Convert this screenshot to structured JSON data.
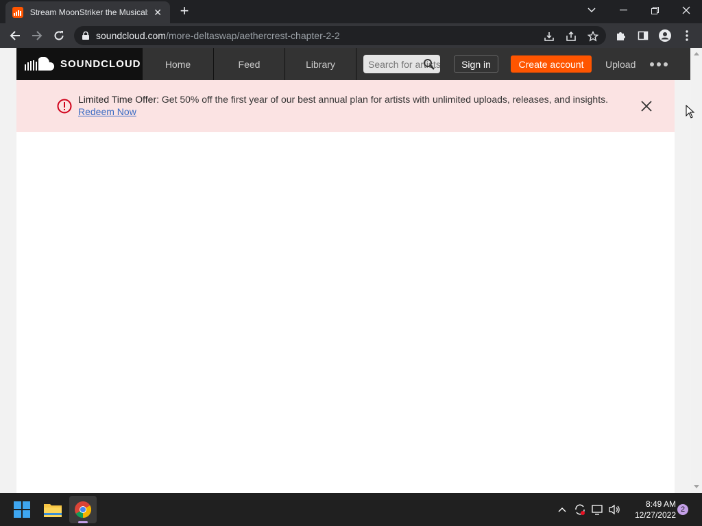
{
  "browser": {
    "tab_title": "Stream MoonStriker the Musical:",
    "tab_close": "✕",
    "new_tab": "+",
    "url_domain": "soundcloud.com",
    "url_path": "/more-deltaswap/aethercrest-chapter-2-2"
  },
  "soundcloud": {
    "logo_text": "SOUNDCLOUD",
    "nav": [
      "Home",
      "Feed",
      "Library"
    ],
    "search_placeholder": "Search for artists",
    "sign_in": "Sign in",
    "create_account": "Create account",
    "upload": "Upload"
  },
  "banner": {
    "strong": "Limited Time Offer:",
    "text": " Get 50% off the first year of our best annual plan for artists with unlimited uploads, releases, and insights. ",
    "link": "Redeem Now"
  },
  "taskbar": {
    "time": "8:49 AM",
    "date": "12/27/2022",
    "notification_count": "2"
  },
  "colors": {
    "accent": "#ff5500",
    "banner_bg": "#fbe3e3",
    "alert_red": "#d0021b"
  }
}
